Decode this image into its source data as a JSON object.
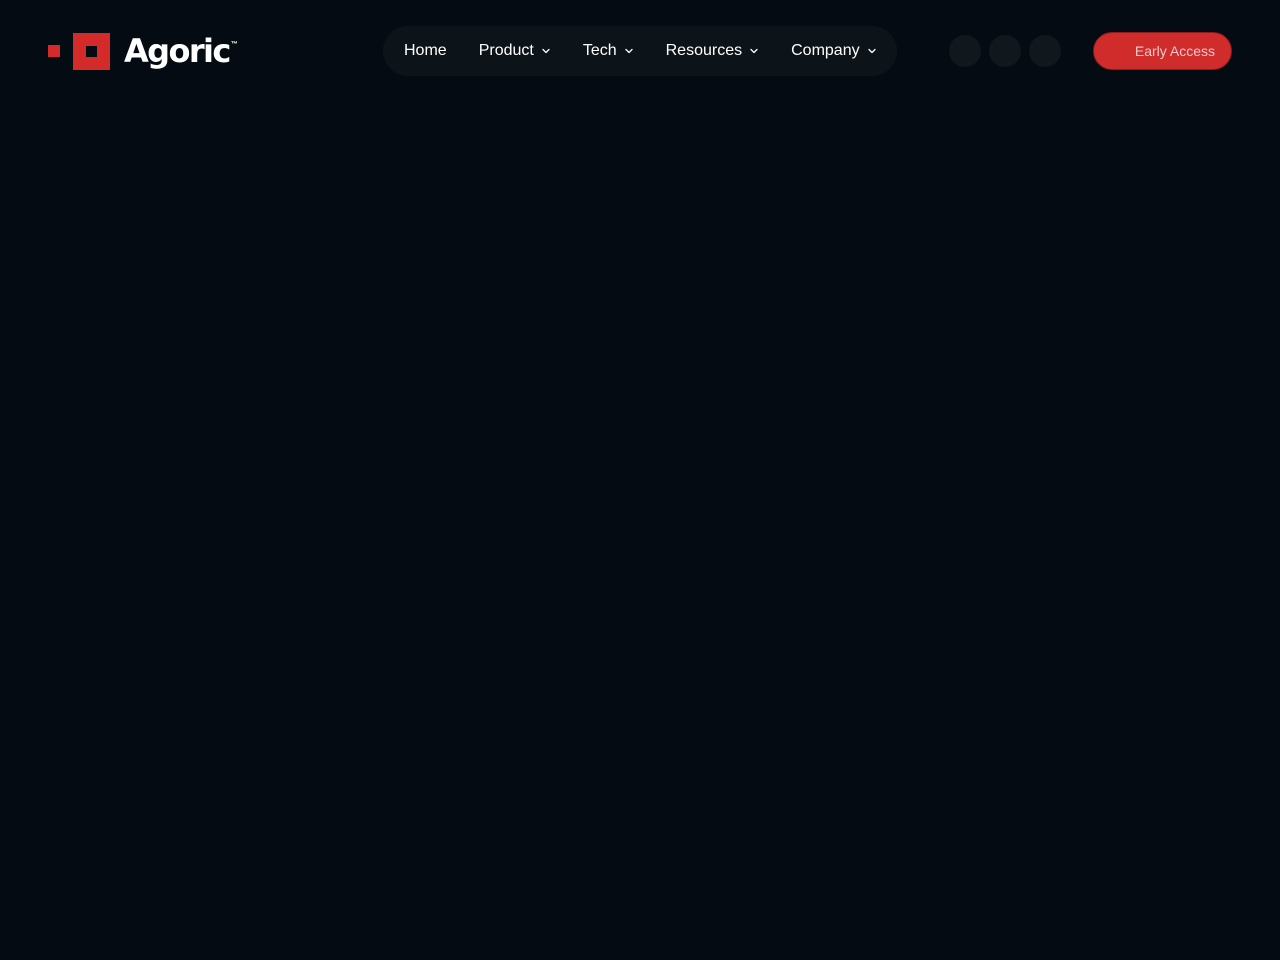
{
  "logo": {
    "name": "Agoric",
    "trademark": "™"
  },
  "nav": {
    "items": [
      {
        "label": "Home",
        "has_dropdown": false
      },
      {
        "label": "Product",
        "has_dropdown": true
      },
      {
        "label": "Tech",
        "has_dropdown": true
      },
      {
        "label": "Resources",
        "has_dropdown": true
      },
      {
        "label": "Company",
        "has_dropdown": true
      }
    ]
  },
  "socials": [
    {
      "icon": "social-icon"
    },
    {
      "icon": "social-icon"
    },
    {
      "icon": "social-icon"
    }
  ],
  "cta": {
    "label": "Early Access"
  },
  "colors": {
    "background": "#050b12",
    "nav_bg": "#0d1419",
    "accent": "#d42a2a",
    "text": "#ffffff"
  }
}
